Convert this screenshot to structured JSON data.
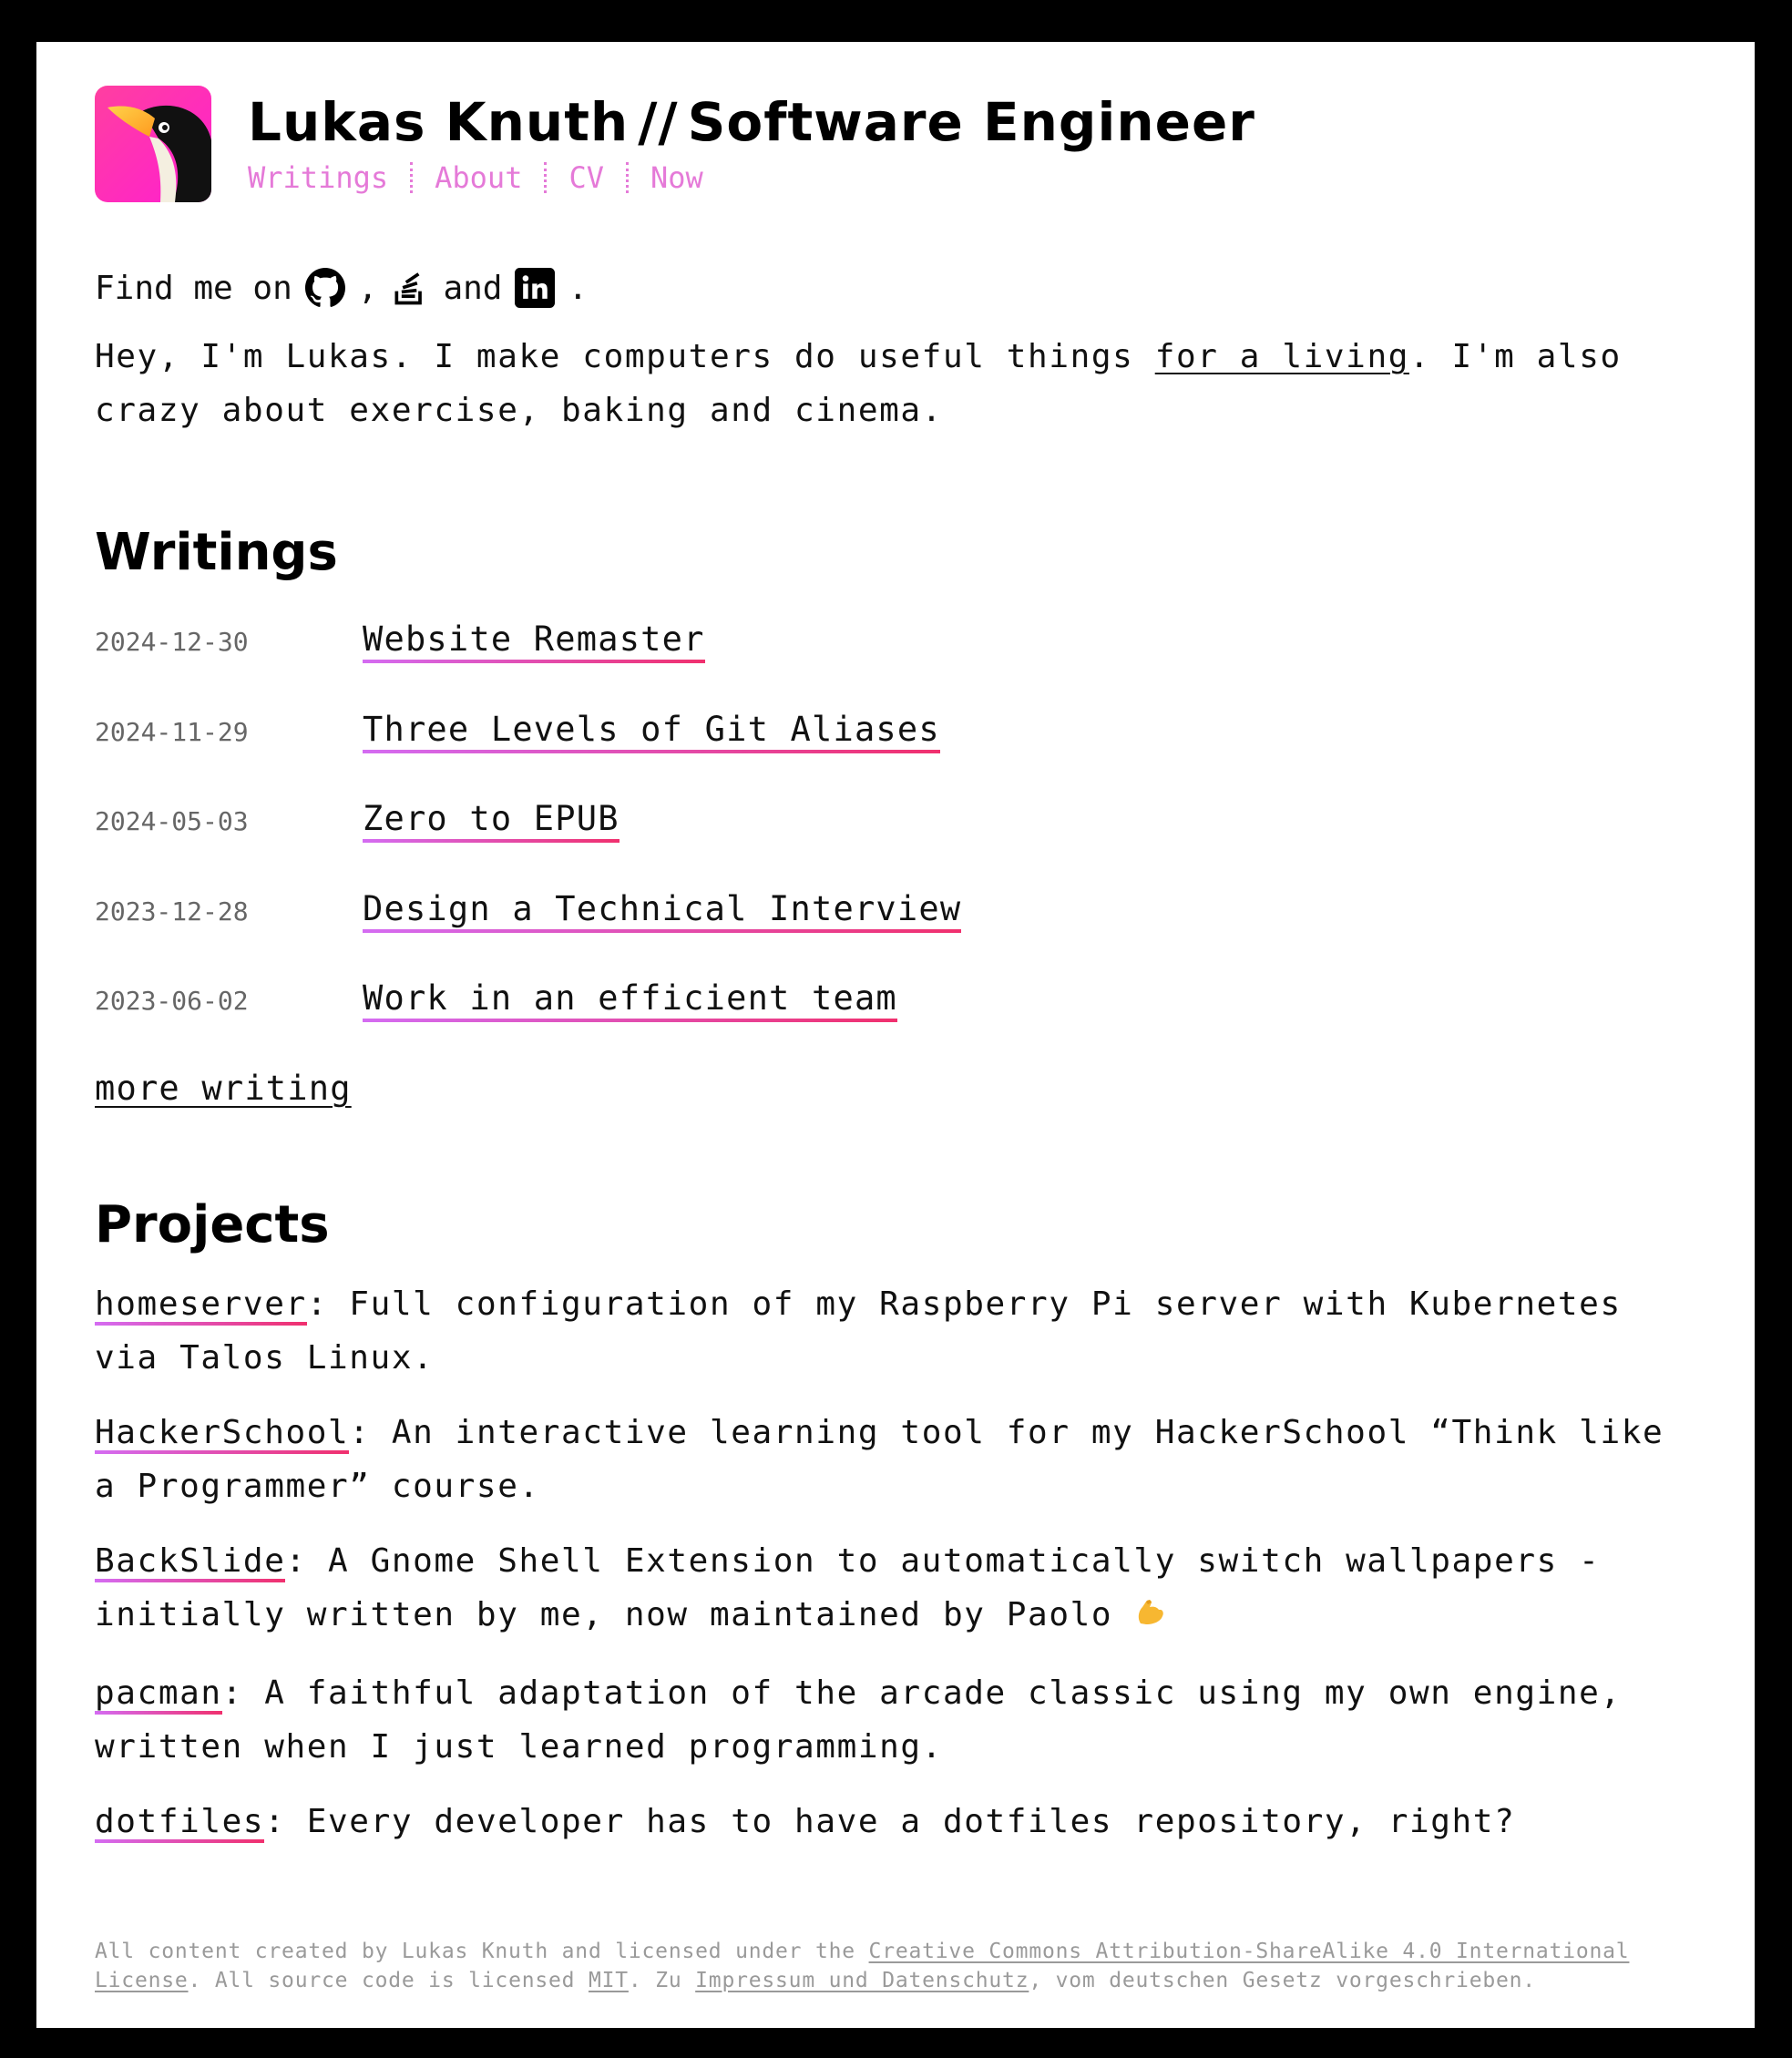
{
  "header": {
    "name": "Lukas Knuth",
    "separator": "//",
    "role": "Software Engineer",
    "nav": [
      "Writings",
      "About",
      "CV",
      "Now"
    ]
  },
  "social": {
    "prefix": "Find me on",
    "comma": ",",
    "and": "and",
    "period": ".",
    "icons": [
      "github-icon",
      "stackoverflow-icon",
      "linkedin-icon"
    ]
  },
  "intro": {
    "before": "Hey, I'm Lukas. I make computers do useful things ",
    "link": "for a living",
    "after": ". I'm also crazy about exer­cise, baking and cinema."
  },
  "writings": {
    "heading": "Writings",
    "posts": [
      {
        "date": "2024-12-30",
        "title": "Website Remaster"
      },
      {
        "date": "2024-11-29",
        "title": "Three Levels of Git Aliases"
      },
      {
        "date": "2024-05-03",
        "title": "Zero to EPUB"
      },
      {
        "date": "2023-12-28",
        "title": "Design a Technical Interview"
      },
      {
        "date": "2023-06-02",
        "title": "Work in an efficient team"
      }
    ],
    "more": "more writing"
  },
  "projects": {
    "heading": "Projects",
    "items": [
      {
        "name": "homeserver",
        "desc": ": Full configuration of my Raspberry Pi server with Kubernetes via Talos Linux."
      },
      {
        "name": "HackerSchool",
        "desc": ": An interactive learning tool for my HackerSchool “Think like a Programmer” course."
      },
      {
        "name": "BackSlide",
        "desc": ": A Gnome Shell Extension to automatically switch wallpapers - initially written by me, now maintained by Paolo "
      },
      {
        "name": "pacman",
        "desc": ": A faithful adaptation of the arcade classic using my own engine, written when I just learned programming."
      },
      {
        "name": "dotfiles",
        "desc": ": Every developer has to have a dotfiles repository, right?"
      }
    ]
  },
  "footer": {
    "t1": "All content created by Lukas Knuth and licensed under the ",
    "license": "Creative Commons Attribution-ShareAlike 4.0 International License",
    "t2": ". All source code is licensed ",
    "mit": "MIT",
    "t3": ". Zu ",
    "impressum": "Impressum und Datenschutz",
    "t4": ", vom deutschen Gesetz vorgeschrieben."
  },
  "colors": {
    "accent_pink": "#e57ad8",
    "underline_start": "#d46cf2",
    "underline_end": "#f0306e",
    "logo_pink": "#ff2fb8"
  }
}
